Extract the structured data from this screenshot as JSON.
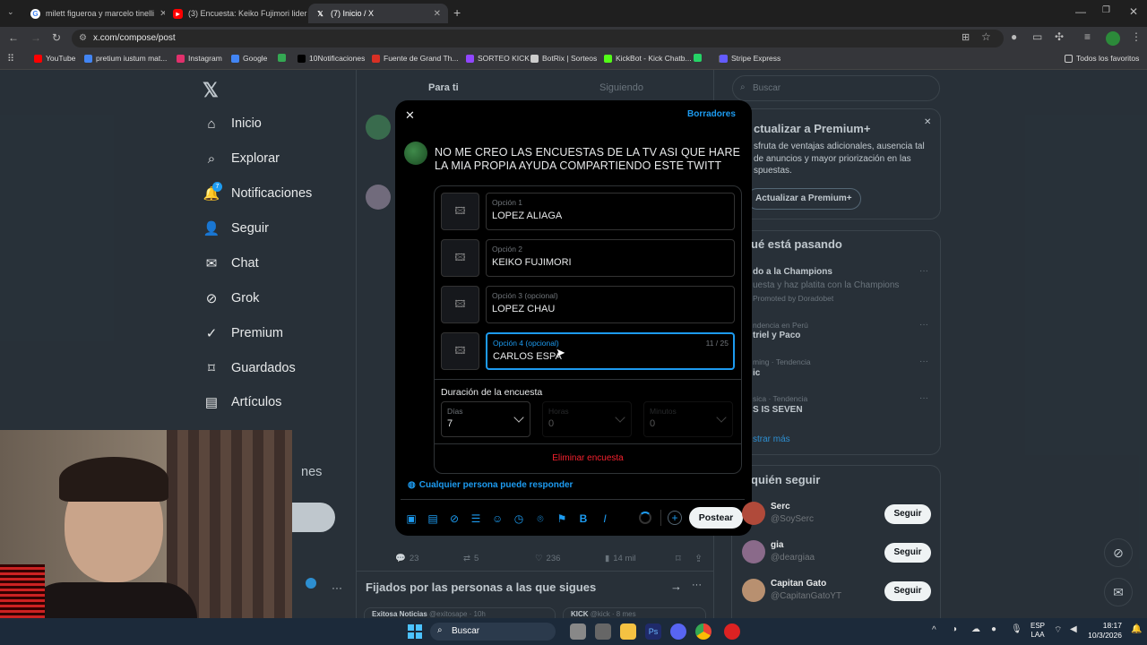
{
  "browser": {
    "tabs": [
      {
        "title": "milett figueroa y marcelo tinelli"
      },
      {
        "title": "(3) Encuesta: Keiko Fujimori lidera"
      },
      {
        "title": "(7) Inicio / X"
      }
    ],
    "url": "x.com/compose/post",
    "bookmarks": [
      {
        "label": "YouTube",
        "color": "#ff0000"
      },
      {
        "label": "pretium iustum mat...",
        "color": "#4285f4"
      },
      {
        "label": "Instagram",
        "color": "#e1306c"
      },
      {
        "label": "Google",
        "color": "#4285f4"
      },
      {
        "label": "",
        "color": "#34a853"
      },
      {
        "label": "10Notificaciones",
        "color": "#000000"
      },
      {
        "label": "Fuente de Grand Th...",
        "color": "#d93025"
      },
      {
        "label": "SORTEO KICK",
        "color": "#9146ff"
      },
      {
        "label": "BotRix | Sorteos",
        "color": "#cccccc"
      },
      {
        "label": "KickBot - Kick Chatb...",
        "color": "#53fc18"
      },
      {
        "label": "",
        "color": "#25d366"
      },
      {
        "label": "|",
        "color": "#35363a"
      },
      {
        "label": "Stripe Express",
        "color": "#635bff"
      }
    ],
    "all_favorites": "Todos los favoritos"
  },
  "nav": {
    "items": [
      {
        "label": "Inicio",
        "icon": "home-icon"
      },
      {
        "label": "Explorar",
        "icon": "search-icon"
      },
      {
        "label": "Notificaciones",
        "icon": "bell-icon",
        "badge": "7"
      },
      {
        "label": "Seguir",
        "icon": "add-user-icon"
      },
      {
        "label": "Chat",
        "icon": "mail-icon"
      },
      {
        "label": "Grok",
        "icon": "grok-icon"
      },
      {
        "label": "Premium",
        "icon": "verified-icon"
      },
      {
        "label": "Guardados",
        "icon": "bookmark-icon"
      },
      {
        "label": "Artículos",
        "icon": "article-icon"
      }
    ],
    "partial_more": "nes"
  },
  "feed": {
    "tabs": [
      "Para ti",
      "Siguiendo"
    ],
    "actions": {
      "replies": "23",
      "reposts": "5",
      "likes": "236",
      "views": "14 mil"
    },
    "pinned_title": "Fijados por las personas a las que sigues",
    "pinned_items": [
      "Exitosa Noticias",
      "@exitosape · 10h",
      "KICK",
      "@kick · 8 mes"
    ]
  },
  "modal": {
    "drafts": "Borradores",
    "post_text": "NO ME CREO LAS ENCUESTAS DE LA TV ASI QUE HARE LA MIA PROPIA AYUDA COMPARTIENDO ESTE TWITT",
    "options": [
      {
        "label": "Opción 1",
        "value": "LOPEZ ALIAGA"
      },
      {
        "label": "Opción 2",
        "value": "KEIKO FUJIMORI"
      },
      {
        "label": "Opción 3 (opcional)",
        "value": "LOPEZ CHAU"
      },
      {
        "label": "Opción 4 (opcional)",
        "value": "CARLOS ESPA",
        "counter": "11 / 25"
      }
    ],
    "duration_title": "Duración de la encuesta",
    "duration": [
      {
        "label": "Días",
        "value": "7"
      },
      {
        "label": "Horas",
        "value": "0"
      },
      {
        "label": "Minutos",
        "value": "0"
      }
    ],
    "remove_poll": "Eliminar encuesta",
    "reply_setting": "Cualquier persona puede responder",
    "post_button": "Postear"
  },
  "right": {
    "search_placeholder": "Buscar",
    "premium": {
      "title": "ctualizar a Premium+",
      "body": "sfruta de ventajas adicionales, ausencia tal de anuncios y mayor priorización en las spuestas.",
      "button": "Actualizar a Premium+"
    },
    "trends": {
      "title": "ué está pasando",
      "items": [
        {
          "meta": "",
          "title": "do a la Champions",
          "sub": "uesta y haz platita con la Champions"
        },
        {
          "meta": "Promoted by Doradobet",
          "title": "",
          "sub": ""
        },
        {
          "meta": "ndencia en Perú",
          "title": "triel y Paco",
          "sub": ""
        },
        {
          "meta": "ming · Tendencia",
          "title": "ic",
          "sub": ""
        },
        {
          "meta": "sica · Tendencia",
          "title": "S IS SEVEN",
          "sub": ""
        }
      ],
      "more": "strar más"
    },
    "follow": {
      "title": "quién seguir",
      "users": [
        {
          "name": "Serc",
          "handle": "@SoySerc",
          "button": "Seguir"
        },
        {
          "name": "gia",
          "handle": "@deargiaa",
          "button": "Seguir"
        },
        {
          "name": "Capitan Gato",
          "handle": "@CapitanGatoYT",
          "button": "Seguir"
        }
      ]
    }
  },
  "taskbar": {
    "search": "Buscar",
    "lang1": "ESP",
    "lang2": "LAA",
    "time": "18:17",
    "date": "10/3/2026"
  },
  "colors": {
    "accent": "#1d9bf0",
    "danger": "#f4212e"
  }
}
